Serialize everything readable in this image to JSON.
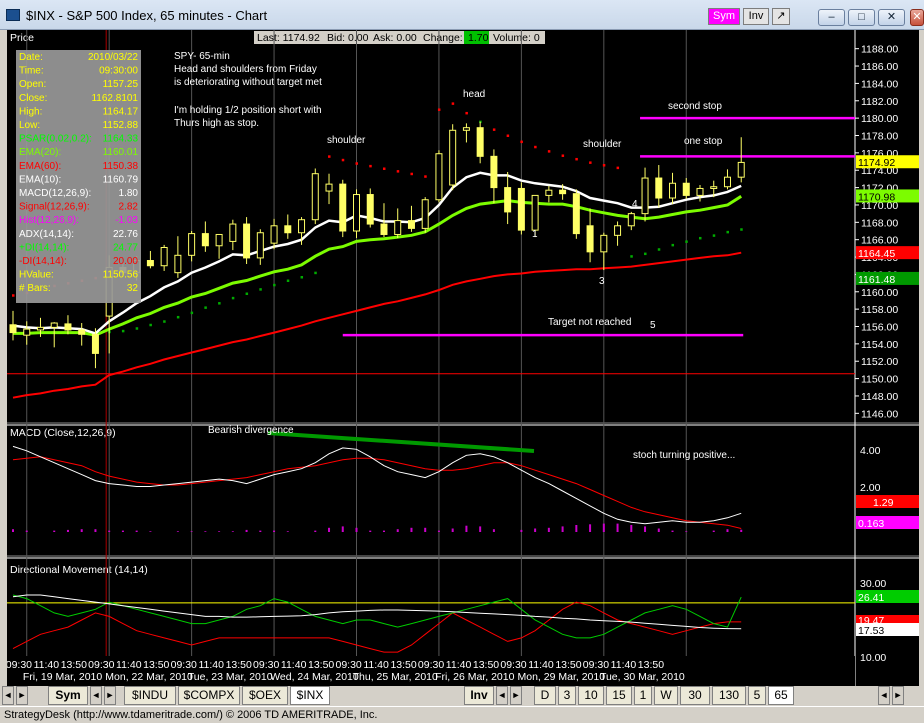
{
  "window": {
    "title": "$INX - S&P 500 Index, 65 minutes - Chart",
    "sym_button": "Sym",
    "inv_button": "Inv",
    "controls": [
      "–",
      "□",
      "✕",
      "✕"
    ]
  },
  "quote_bar": {
    "last": "Last: 1174.92",
    "bid": "Bid: 0.00",
    "ask": "Ask: 0.00",
    "change_label": "Change:",
    "change_value": "1.70",
    "volume": "Volume: 0"
  },
  "price_panel": {
    "title": "Price",
    "y_ticks": [
      1188,
      1186,
      1184,
      1182,
      1180,
      1178,
      1176,
      1174,
      1172,
      1170,
      1168,
      1166,
      1164,
      1162,
      1160,
      1158,
      1156,
      1154,
      1152,
      1150,
      1148,
      1146
    ],
    "price_tags": [
      {
        "label": "1174.92",
        "value": 1174.92,
        "color": "#ffff00"
      },
      {
        "label": "1170.98",
        "value": 1170.98,
        "color": "#7cfc00"
      },
      {
        "label": "1164.45",
        "value": 1164.45,
        "color": "#ff0000"
      },
      {
        "label": "1161.48",
        "value": 1161.48,
        "color": "#009900"
      }
    ],
    "annotations": {
      "note_lines": [
        "SPY- 65-min",
        "Head and shoulders from Friday",
        "is deteriorating without target met",
        "",
        "I'm holding 1/2 position short with",
        "Thurs high as stop."
      ],
      "shoulder_left": "shoulder",
      "head": "head",
      "shoulder_right": "shoulder",
      "second_stop": "second stop",
      "one_stop": "one stop",
      "target": "Target not reached",
      "wave_labels": [
        "1",
        "3",
        "4",
        "5"
      ]
    },
    "data_box": [
      {
        "label": "Date:",
        "value": "2010/03/22",
        "color": "#ffff00"
      },
      {
        "label": "Time:",
        "value": "09:30:00",
        "color": "#ffff00"
      },
      {
        "label": "Open:",
        "value": "1157.25",
        "color": "#ffff00"
      },
      {
        "label": "Close:",
        "value": "1162.8101",
        "color": "#ffff00"
      },
      {
        "label": "High:",
        "value": "1164.17",
        "color": "#ffff00"
      },
      {
        "label": "Low:",
        "value": "1152.88",
        "color": "#ffff00"
      },
      {
        "label": "PSAR(0.02,0.2):",
        "value": "1164.33",
        "color": "#00ff00"
      },
      {
        "label": "EMA(20):",
        "value": "1160.01",
        "color": "#7cfc00"
      },
      {
        "label": "EMA(60):",
        "value": "1150.38",
        "color": "#ff0000"
      },
      {
        "label": "EMA(10):",
        "value": "1160.79",
        "color": "#ffffff"
      },
      {
        "label": "MACD(12,26,9):",
        "value": "1.80",
        "color": "#ffffff"
      },
      {
        "label": "Signal(12,26,9):",
        "value": "2.82",
        "color": "#ff0000"
      },
      {
        "label": "Hist(12,26,9):",
        "value": "-1.03",
        "color": "#ff00ff"
      },
      {
        "label": "ADX(14,14):",
        "value": "22.76",
        "color": "#ffffff"
      },
      {
        "label": "+DI(14,14):",
        "value": "24.77",
        "color": "#00ff00"
      },
      {
        "label": "-DI(14,14):",
        "value": "20.00",
        "color": "#ff0000"
      },
      {
        "label": "HValue:",
        "value": "1150.56",
        "color": "#ffff00"
      },
      {
        "label": "# Bars:",
        "value": "32",
        "color": "#ffff00"
      }
    ]
  },
  "macd_panel": {
    "title": "MACD (Close,12,26,9)",
    "note_divergence": "Bearish divergence",
    "note_stoch": "stoch turning positive...",
    "ticks": [
      "4.00",
      "2.00"
    ],
    "tags": [
      {
        "label": "1.29",
        "color": "#ff0000"
      },
      {
        "label": "0.163",
        "color": "#ff00ff"
      }
    ]
  },
  "dmi_panel": {
    "title": "Directional Movement (14,14)",
    "ticks": [
      "30.00",
      "10.00"
    ],
    "tags": [
      {
        "label": "26.41",
        "color": "#00cc00"
      },
      {
        "label": "19.47",
        "color": "#ff0000"
      },
      {
        "label": "17.53",
        "color": "#ffffff"
      }
    ]
  },
  "x_axis": {
    "times": [
      "09:30",
      "11:40",
      "13:50",
      "09:30",
      "11:40",
      "13:50",
      "09:30",
      "11:40",
      "13:50",
      "09:30",
      "11:40",
      "13:50",
      "09:30",
      "11:40",
      "13:50",
      "09:30",
      "11:40",
      "13:50",
      "09:30",
      "11:40",
      "13:50",
      "09:30",
      "11:40",
      "13:50"
    ],
    "days": [
      "Fri, 19 Mar, 2010",
      "Mon, 22 Mar, 2010",
      "Tue, 23 Mar, 2010",
      "Wed, 24 Mar, 2010",
      "Thu, 25 Mar, 2010",
      "Fri, 26 Mar, 2010",
      "Mon, 29 Mar, 2010",
      "Tue, 30 Mar, 2010"
    ]
  },
  "bottom_bar": {
    "sym_label": "Sym",
    "symbols": [
      "$INDU",
      "$COMPX",
      "$OEX",
      "$INX"
    ],
    "inv_label": "Inv",
    "periods": [
      "D",
      "3",
      "10",
      "15",
      "1",
      "W",
      "30",
      "130",
      "5",
      "65"
    ]
  },
  "status_bar": "StrategyDesk (http://www.tdameritrade.com/) © 2006 TD AMERITRADE, Inc.",
  "chart_data": {
    "type": "candlestick",
    "interval": "65 minutes",
    "y_range": [
      1145,
      1189
    ],
    "candles": [
      {
        "o": 1156.2,
        "h": 1157.8,
        "l": 1154.4,
        "c": 1155.3
      },
      {
        "o": 1155.0,
        "h": 1156.6,
        "l": 1153.9,
        "c": 1155.7
      },
      {
        "o": 1155.6,
        "h": 1157.0,
        "l": 1154.8,
        "c": 1155.9
      },
      {
        "o": 1155.9,
        "h": 1156.5,
        "l": 1153.6,
        "c": 1156.4
      },
      {
        "o": 1156.3,
        "h": 1157.3,
        "l": 1155.1,
        "c": 1155.6
      },
      {
        "o": 1155.6,
        "h": 1156.4,
        "l": 1153.8,
        "c": 1155.1
      },
      {
        "o": 1155.1,
        "h": 1155.8,
        "l": 1151.2,
        "c": 1152.9
      },
      {
        "o": 1157.2,
        "h": 1164.2,
        "l": 1152.9,
        "c": 1162.8
      },
      {
        "o": 1162.8,
        "h": 1163.6,
        "l": 1161.9,
        "c": 1162.2
      },
      {
        "o": 1162.2,
        "h": 1164.1,
        "l": 1161.3,
        "c": 1163.6
      },
      {
        "o": 1163.6,
        "h": 1164.7,
        "l": 1162.7,
        "c": 1163.0
      },
      {
        "o": 1163.0,
        "h": 1165.4,
        "l": 1162.4,
        "c": 1165.1
      },
      {
        "o": 1162.2,
        "h": 1166.4,
        "l": 1161.6,
        "c": 1164.2
      },
      {
        "o": 1164.2,
        "h": 1167.0,
        "l": 1163.5,
        "c": 1166.7
      },
      {
        "o": 1166.7,
        "h": 1168.1,
        "l": 1164.6,
        "c": 1165.3
      },
      {
        "o": 1165.3,
        "h": 1166.1,
        "l": 1163.8,
        "c": 1166.6
      },
      {
        "o": 1165.8,
        "h": 1168.3,
        "l": 1164.8,
        "c": 1167.8
      },
      {
        "o": 1167.8,
        "h": 1168.6,
        "l": 1163.2,
        "c": 1163.9
      },
      {
        "o": 1163.9,
        "h": 1167.2,
        "l": 1163.1,
        "c": 1166.8
      },
      {
        "o": 1165.6,
        "h": 1168.4,
        "l": 1164.9,
        "c": 1167.6
      },
      {
        "o": 1167.6,
        "h": 1168.9,
        "l": 1166.1,
        "c": 1166.8
      },
      {
        "o": 1166.8,
        "h": 1168.6,
        "l": 1165.4,
        "c": 1168.3
      },
      {
        "o": 1168.3,
        "h": 1174.2,
        "l": 1167.8,
        "c": 1173.6
      },
      {
        "o": 1171.6,
        "h": 1173.6,
        "l": 1170.1,
        "c": 1172.4
      },
      {
        "o": 1172.4,
        "h": 1172.9,
        "l": 1166.3,
        "c": 1167.0
      },
      {
        "o": 1167.0,
        "h": 1171.8,
        "l": 1166.2,
        "c": 1171.2
      },
      {
        "o": 1171.2,
        "h": 1171.9,
        "l": 1167.4,
        "c": 1167.8
      },
      {
        "o": 1167.8,
        "h": 1170.2,
        "l": 1166.3,
        "c": 1166.6
      },
      {
        "o": 1166.6,
        "h": 1169.6,
        "l": 1166.2,
        "c": 1168.2
      },
      {
        "o": 1168.2,
        "h": 1169.9,
        "l": 1166.9,
        "c": 1167.3
      },
      {
        "o": 1167.3,
        "h": 1170.9,
        "l": 1166.8,
        "c": 1170.6
      },
      {
        "o": 1170.6,
        "h": 1176.3,
        "l": 1170.3,
        "c": 1175.9
      },
      {
        "o": 1172.3,
        "h": 1179.3,
        "l": 1171.7,
        "c": 1178.6
      },
      {
        "o": 1178.6,
        "h": 1179.4,
        "l": 1177.2,
        "c": 1178.9
      },
      {
        "o": 1178.9,
        "h": 1179.6,
        "l": 1174.8,
        "c": 1175.6
      },
      {
        "o": 1175.6,
        "h": 1176.4,
        "l": 1170.2,
        "c": 1172.0
      },
      {
        "o": 1172.0,
        "h": 1173.8,
        "l": 1167.8,
        "c": 1169.2
      },
      {
        "o": 1171.9,
        "h": 1172.6,
        "l": 1166.6,
        "c": 1167.1
      },
      {
        "o": 1167.1,
        "h": 1168.9,
        "l": 1166.3,
        "c": 1171.1
      },
      {
        "o": 1171.1,
        "h": 1172.2,
        "l": 1170.3,
        "c": 1171.7
      },
      {
        "o": 1171.7,
        "h": 1172.4,
        "l": 1170.6,
        "c": 1171.3
      },
      {
        "o": 1171.3,
        "h": 1171.8,
        "l": 1166.1,
        "c": 1166.7
      },
      {
        "o": 1167.6,
        "h": 1169.6,
        "l": 1163.4,
        "c": 1164.6
      },
      {
        "o": 1164.6,
        "h": 1166.8,
        "l": 1162.5,
        "c": 1166.5
      },
      {
        "o": 1166.5,
        "h": 1168.1,
        "l": 1165.3,
        "c": 1167.6
      },
      {
        "o": 1167.6,
        "h": 1169.2,
        "l": 1167.1,
        "c": 1169.0
      },
      {
        "o": 1169.0,
        "h": 1174.3,
        "l": 1168.1,
        "c": 1173.1
      },
      {
        "o": 1173.1,
        "h": 1174.6,
        "l": 1169.7,
        "c": 1170.8
      },
      {
        "o": 1170.8,
        "h": 1173.7,
        "l": 1170.1,
        "c": 1172.5
      },
      {
        "o": 1172.5,
        "h": 1173.1,
        "l": 1170.7,
        "c": 1171.1
      },
      {
        "o": 1171.1,
        "h": 1172.3,
        "l": 1170.4,
        "c": 1171.9
      },
      {
        "o": 1171.9,
        "h": 1172.8,
        "l": 1170.9,
        "c": 1172.1
      },
      {
        "o": 1172.1,
        "h": 1174.1,
        "l": 1171.8,
        "c": 1173.2
      },
      {
        "o": 1173.2,
        "h": 1177.8,
        "l": 1172.6,
        "c": 1174.9
      }
    ],
    "psar": [
      1159.6,
      1159.9,
      1160.3,
      1160.7,
      1161.0,
      1161.3,
      1161.6,
      1155.4,
      1155.5,
      1155.8,
      1156.2,
      1156.6,
      1157.1,
      1157.6,
      1158.2,
      1158.7,
      1159.3,
      1159.8,
      1160.3,
      1160.8,
      1161.3,
      1161.7,
      1162.2,
      1175.6,
      1175.2,
      1174.8,
      1174.5,
      1174.2,
      1173.9,
      1173.6,
      1173.3,
      1181.0,
      1181.7,
      1180.6,
      1179.6,
      1178.7,
      1178.0,
      1177.3,
      1176.7,
      1176.2,
      1175.7,
      1175.3,
      1174.9,
      1174.6,
      1174.3,
      1164.1,
      1164.4,
      1164.9,
      1165.4,
      1165.8,
      1166.2,
      1166.5,
      1166.9,
      1167.2
    ],
    "ema10": [
      1156.1,
      1155.9,
      1155.8,
      1155.9,
      1155.8,
      1155.7,
      1155.2,
      1156.6,
      1157.6,
      1158.7,
      1159.5,
      1160.5,
      1161.2,
      1162.2,
      1162.8,
      1163.5,
      1164.3,
      1164.2,
      1164.7,
      1165.2,
      1165.5,
      1166.0,
      1167.4,
      1168.2,
      1168.0,
      1168.8,
      1168.5,
      1168.1,
      1168.1,
      1168.0,
      1168.5,
      1170.0,
      1172.0,
      1173.2,
      1173.7,
      1173.4,
      1173.4,
      1172.8,
      1172.5,
      1172.3,
      1172.1,
      1171.6,
      1170.8,
      1170.5,
      1170.2,
      1169.7,
      1169.7,
      1169.8,
      1170.2,
      1170.6,
      1170.9,
      1171.1,
      1171.5,
      1172.2
    ],
    "ema20": [
      1155.2,
      1155.2,
      1155.3,
      1155.3,
      1155.3,
      1155.3,
      1155.0,
      1155.7,
      1156.3,
      1157.0,
      1157.5,
      1158.2,
      1158.7,
      1159.4,
      1159.8,
      1160.4,
      1161.0,
      1161.3,
      1161.8,
      1162.3,
      1162.6,
      1163.1,
      1164.1,
      1164.9,
      1165.2,
      1165.8,
      1166.0,
      1166.1,
      1166.3,
      1166.5,
      1166.9,
      1167.8,
      1168.8,
      1169.6,
      1170.1,
      1170.3,
      1170.5,
      1170.3,
      1170.2,
      1170.1,
      1170.1,
      1169.8,
      1169.4,
      1169.1,
      1168.8,
      1168.6,
      1168.4,
      1168.6,
      1168.9,
      1169.2,
      1169.4,
      1169.7,
      1170.0,
      1171.0
    ],
    "ema60": [
      1147.8,
      1148.1,
      1148.3,
      1148.6,
      1148.8,
      1149.1,
      1149.3,
      1150.4,
      1150.8,
      1151.3,
      1151.7,
      1152.2,
      1152.6,
      1153.0,
      1153.4,
      1153.8,
      1154.2,
      1154.5,
      1154.9,
      1155.3,
      1155.7,
      1156.1,
      1156.6,
      1157.0,
      1157.4,
      1157.8,
      1158.2,
      1158.6,
      1158.9,
      1159.3,
      1159.7,
      1160.2,
      1160.8,
      1161.2,
      1161.5,
      1161.8,
      1162.0,
      1162.1,
      1162.3,
      1162.4,
      1162.5,
      1162.6,
      1162.6,
      1162.7,
      1162.8,
      1162.9,
      1163.1,
      1163.3,
      1163.5,
      1163.7,
      1163.9,
      1164.1,
      1164.2,
      1164.5
    ],
    "horizontal_lines": [
      {
        "value": 1150.56,
        "color": "#ff0000",
        "label": "HValue"
      },
      {
        "value": 1180.0,
        "color": "#ff00ff",
        "label": "second stop"
      },
      {
        "value": 1175.6,
        "color": "#ff00ff",
        "label": "one stop"
      },
      {
        "value": 1155.0,
        "color": "#ff00ff",
        "label": "Target not reached"
      }
    ],
    "macd": {
      "macd_line": [
        4.05,
        3.9,
        3.7,
        3.5,
        3.3,
        3.1,
        2.9,
        2.8,
        2.75,
        2.7,
        2.7,
        2.75,
        2.8,
        2.85,
        2.9,
        2.95,
        2.9,
        2.8,
        2.95,
        3.1,
        3.2,
        3.3,
        3.5,
        3.8,
        4.0,
        3.95,
        3.7,
        3.4,
        3.2,
        3.1,
        3.0,
        3.2,
        3.5,
        3.75,
        3.8,
        3.7,
        3.5,
        3.25,
        3.0,
        2.8,
        2.55,
        2.3,
        2.05,
        1.8,
        1.6,
        1.5,
        1.45,
        1.5,
        1.55,
        1.5,
        1.5,
        1.55,
        1.65,
        1.8
      ],
      "signal_line": [
        3.6,
        3.65,
        3.7,
        3.6,
        3.5,
        3.4,
        3.2,
        3.05,
        2.95,
        2.85,
        2.8,
        2.75,
        2.75,
        2.8,
        2.85,
        2.9,
        2.95,
        3.0,
        3.1,
        3.2,
        3.3,
        3.35,
        3.4,
        3.5,
        3.6,
        3.65,
        3.65,
        3.6,
        3.5,
        3.4,
        3.3,
        3.25,
        3.25,
        3.3,
        3.4,
        3.5,
        3.5,
        3.4,
        3.25,
        3.1,
        2.95,
        2.8,
        2.6,
        2.4,
        2.2,
        2.0,
        1.85,
        1.75,
        1.65,
        1.55,
        1.5,
        1.45,
        1.4,
        1.29
      ],
      "hist": [
        0.2,
        0.1,
        0.0,
        -0.1,
        -0.15,
        -0.2,
        -0.2,
        -0.1,
        -0.1,
        -0.1,
        -0.05,
        0.0,
        0.05,
        0.05,
        0.05,
        0.05,
        -0.05,
        -0.15,
        -0.1,
        -0.1,
        -0.05,
        0.0,
        0.1,
        0.3,
        0.4,
        0.3,
        0.1,
        -0.1,
        -0.2,
        -0.3,
        -0.3,
        -0.1,
        0.25,
        0.45,
        0.4,
        0.2,
        0.0,
        -0.15,
        -0.25,
        -0.3,
        -0.4,
        -0.5,
        -0.55,
        -0.6,
        -0.6,
        -0.5,
        -0.4,
        -0.25,
        -0.1,
        -0.05,
        0.0,
        0.1,
        0.2,
        0.163
      ],
      "y_range": [
        0.5,
        4.6
      ]
    },
    "dmi": {
      "plus_di": [
        27,
        26,
        24,
        22,
        21,
        22,
        23,
        25,
        24,
        23,
        22,
        21,
        20,
        19,
        19,
        20,
        21,
        23,
        24,
        26,
        25,
        23,
        21,
        20,
        19,
        20,
        20,
        19,
        18,
        19,
        20,
        21,
        22,
        23,
        24,
        25,
        26,
        23,
        20,
        18,
        16,
        15,
        15,
        16,
        18,
        20,
        22,
        23,
        24,
        23,
        21,
        19,
        18,
        26.41
      ],
      "minus_di": [
        12,
        14,
        16,
        17,
        18,
        20,
        22,
        21,
        19,
        17,
        16,
        15,
        14,
        13,
        14,
        15,
        15,
        15,
        15,
        15,
        15,
        15,
        15,
        15,
        14,
        13,
        12,
        11,
        11,
        13,
        16,
        19,
        22,
        20,
        18,
        16,
        14,
        15,
        17,
        20,
        23,
        25,
        24,
        22,
        20,
        19,
        18,
        17,
        16,
        17,
        18,
        19,
        19.47,
        19.47
      ],
      "adx": [
        26.5,
        27,
        27,
        26.5,
        26,
        25.5,
        25,
        24.5,
        24,
        23.5,
        23,
        22.5,
        22,
        21.5,
        21,
        21,
        20.8,
        20.8,
        20.9,
        21,
        21.1,
        21.2,
        21.5,
        22,
        22.3,
        22.5,
        22.7,
        22.8,
        22.8,
        22.7,
        22.6,
        22.5,
        22.3,
        22.1,
        21.9,
        21.7,
        21.5,
        21.3,
        21,
        20.8,
        20.5,
        20.3,
        20,
        19.8,
        19.6,
        19.4,
        19.1,
        18.8,
        18.5,
        18.2,
        17.9,
        17.7,
        17.6,
        17.53
      ],
      "y_range": [
        6,
        34
      ],
      "y_hline": 24.8
    }
  }
}
